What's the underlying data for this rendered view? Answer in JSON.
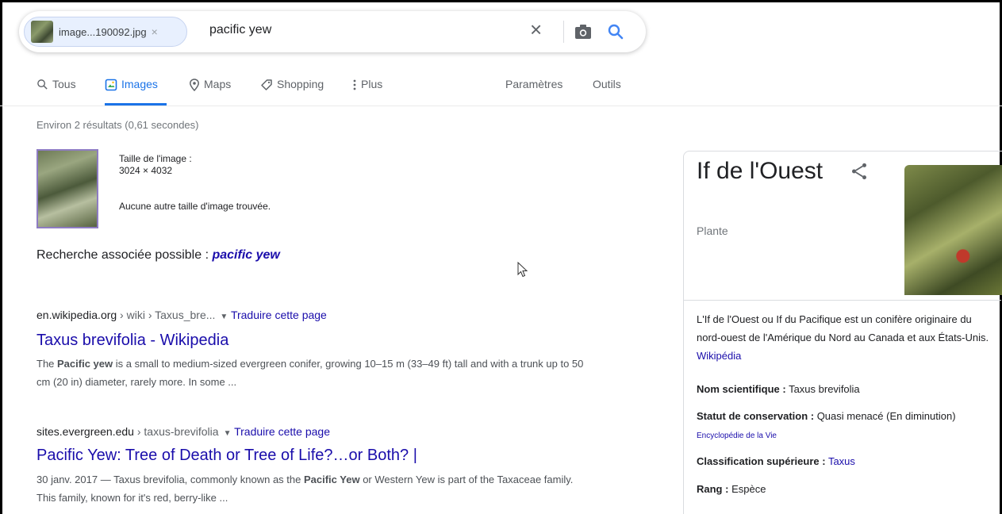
{
  "search": {
    "chip_filename": "image...190092.jpg",
    "chip_close": "×",
    "query": "pacific yew",
    "clear": "×"
  },
  "tabs": [
    {
      "label": "Tous"
    },
    {
      "label": "Images"
    },
    {
      "label": "Maps"
    },
    {
      "label": "Shopping"
    },
    {
      "label": "Plus"
    },
    {
      "label": "Paramètres"
    },
    {
      "label": "Outils"
    }
  ],
  "stats": "Environ 2 résultats (0,61 secondes)",
  "image_info": {
    "size_label": "Taille de l'image :",
    "size_value": "3024 × 4032",
    "no_other": "Aucune autre taille d'image trouvée."
  },
  "related": {
    "prefix": "Recherche associée possible :",
    "link": "pacific yew"
  },
  "results": [
    {
      "domain": "en.wikipedia.org",
      "path": " › wiki › Taxus_bre...",
      "translate": "Traduire cette page",
      "title": "Taxus brevifolia - Wikipedia",
      "snippet_pre": "The ",
      "snippet_bold": "Pacific yew",
      "snippet_post": " is a small to medium-sized evergreen conifer, growing 10–15 m (33–49 ft) tall and with a trunk up to 50 cm (20 in) diameter, rarely more. In some ..."
    },
    {
      "domain": "sites.evergreen.edu",
      "path": " › taxus-brevifolia",
      "translate": "Traduire cette page",
      "title": "Pacific Yew: Tree of Death or Tree of Life?…or Both? |",
      "snippet_pre": "30 janv. 2017 — Taxus brevifolia, commonly known as the ",
      "snippet_bold": "Pacific Yew",
      "snippet_post": " or Western Yew is part of the Taxaceae family. This family, known for it's red, berry-like ..."
    }
  ],
  "knowledge_panel": {
    "title": "If de l'Ouest",
    "subtitle": "Plante",
    "description": "L'If de l'Ouest ou If du Pacifique est un conifère originaire du nord-ouest de l'Amérique du Nord au Canada et aux États-Unis.",
    "source": "Wikipédia",
    "facts": [
      {
        "key": "Nom scientifique :",
        "value": " Taxus brevifolia"
      },
      {
        "key": "Statut de conservation :",
        "value": " Quasi menacé (En diminution)",
        "link_small": "Encyclopédie de la Vie"
      },
      {
        "key": "Classification supérieure :",
        "link": "Taxus"
      },
      {
        "key": "Rang :",
        "value": " Espèce"
      }
    ]
  },
  "colors": {
    "accent": "#1a73e8",
    "link": "#1a0dab"
  }
}
